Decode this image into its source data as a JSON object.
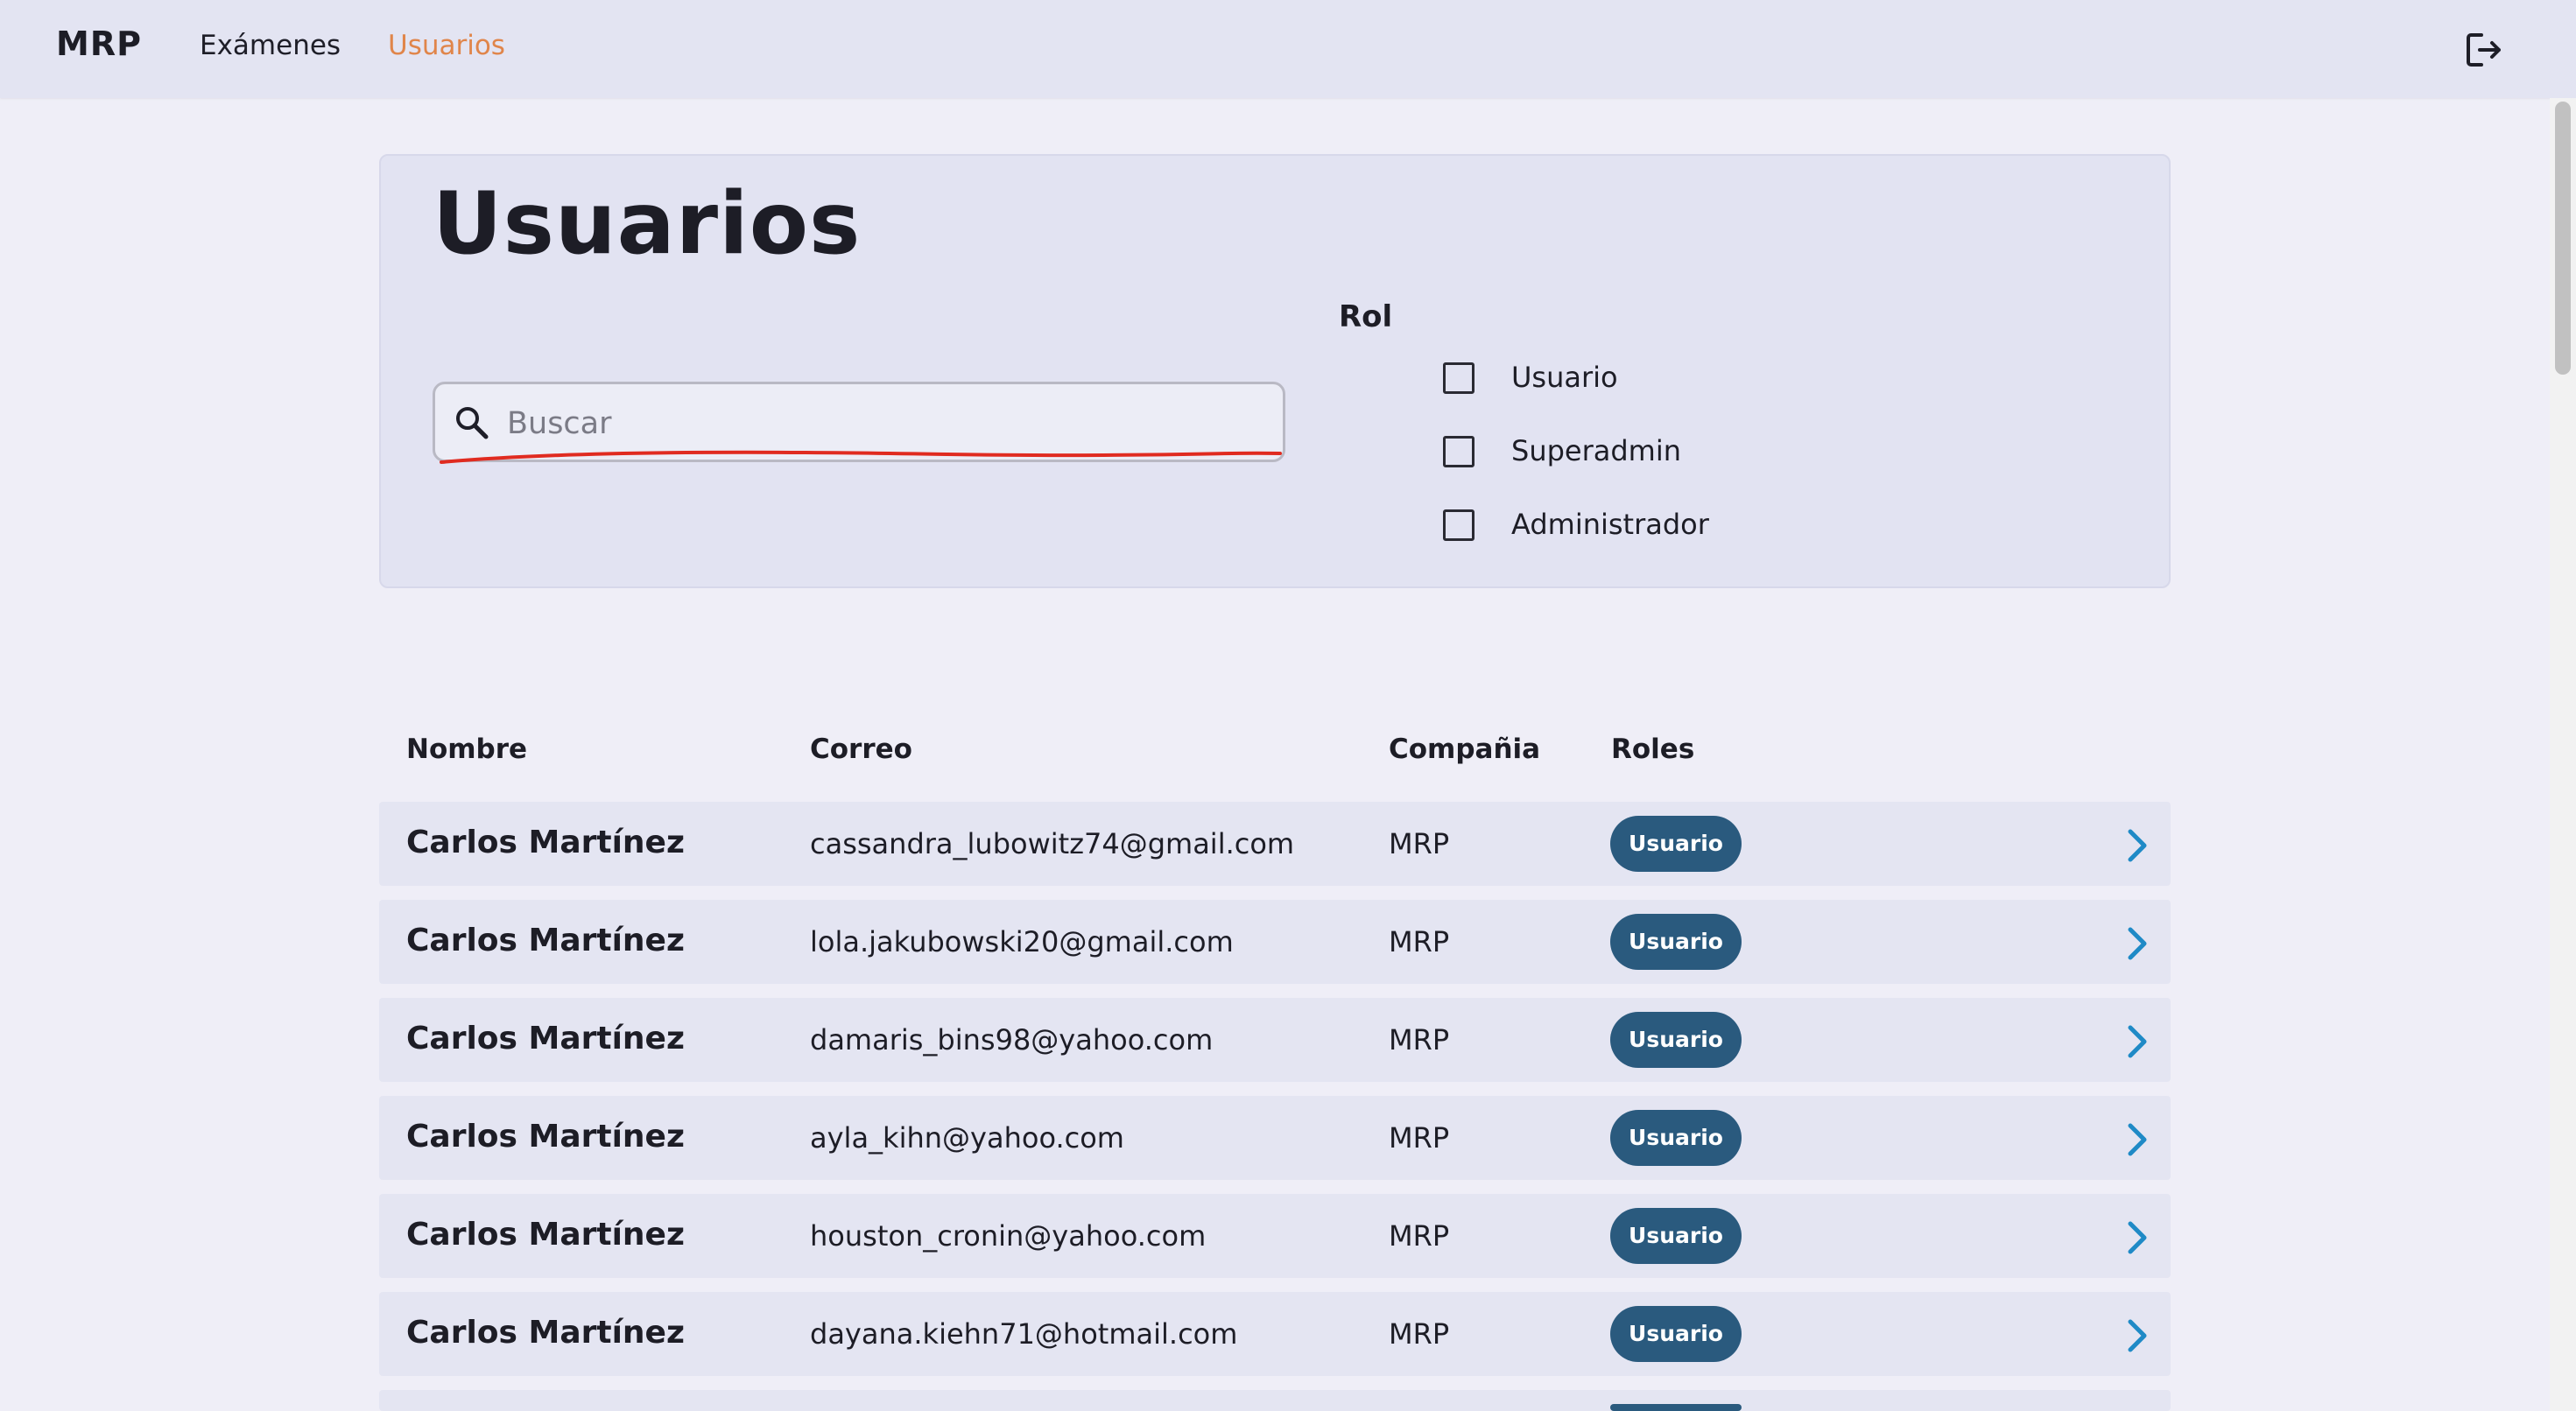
{
  "app": {
    "brand": "MRP",
    "nav": [
      {
        "label": "Exámenes",
        "active": false
      },
      {
        "label": "Usuarios",
        "active": true
      }
    ],
    "logout_icon": "logout-icon"
  },
  "page": {
    "title": "Usuarios",
    "search": {
      "placeholder": "Buscar",
      "value": "",
      "icon": "search-icon"
    },
    "role_filter": {
      "label": "Rol",
      "options": [
        {
          "label": "Usuario",
          "checked": false
        },
        {
          "label": "Superadmin",
          "checked": false
        },
        {
          "label": "Administrador",
          "checked": false
        }
      ]
    }
  },
  "table": {
    "columns": [
      "Nombre",
      "Correo",
      "Compañia",
      "Roles"
    ],
    "rows": [
      {
        "name": "Carlos Martínez",
        "email": "cassandra_lubowitz74@gmail.com",
        "company": "MRP",
        "role": "Usuario"
      },
      {
        "name": "Carlos Martínez",
        "email": "lola.jakubowski20@gmail.com",
        "company": "MRP",
        "role": "Usuario"
      },
      {
        "name": "Carlos Martínez",
        "email": "damaris_bins98@yahoo.com",
        "company": "MRP",
        "role": "Usuario"
      },
      {
        "name": "Carlos Martínez",
        "email": "ayla_kihn@yahoo.com",
        "company": "MRP",
        "role": "Usuario"
      },
      {
        "name": "Carlos Martínez",
        "email": "houston_cronin@yahoo.com",
        "company": "MRP",
        "role": "Usuario"
      },
      {
        "name": "Carlos Martínez",
        "email": "dayana.kiehn71@hotmail.com",
        "company": "MRP",
        "role": "Usuario"
      }
    ]
  },
  "colors": {
    "accent_nav": "#e0854a",
    "badge_bg": "#2a5a7e",
    "chevron": "#1f8ac6",
    "annotation": "#e02b20",
    "background": "#efeef7"
  }
}
